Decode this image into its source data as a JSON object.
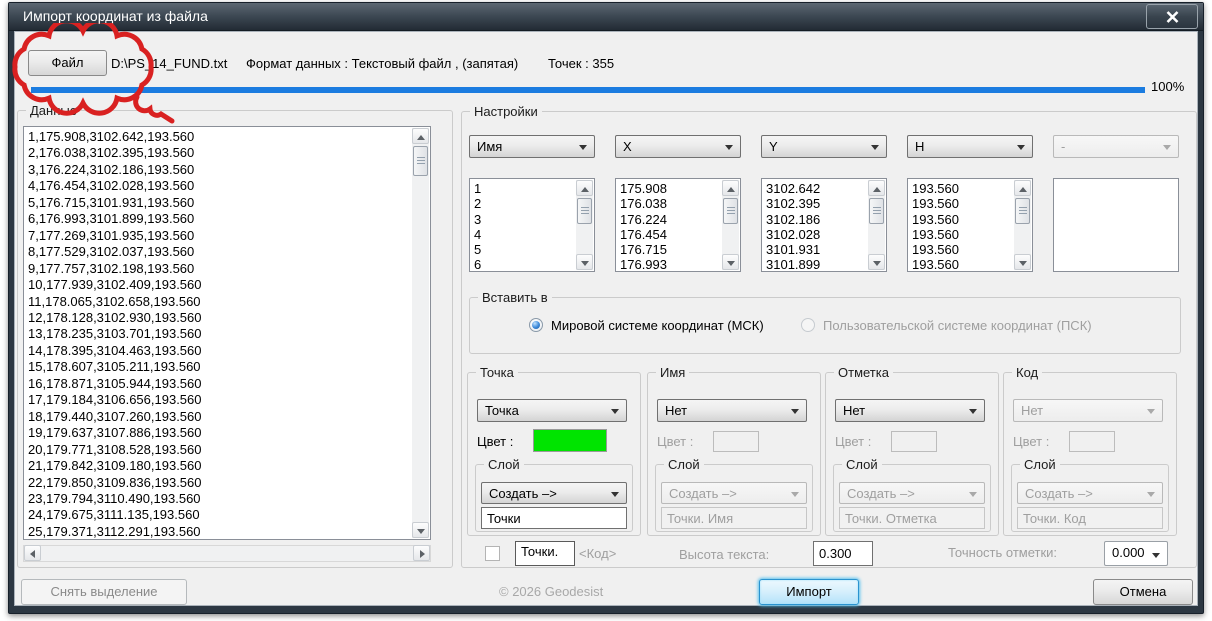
{
  "window": {
    "title": "Импорт координат из файла"
  },
  "header": {
    "file_button": "Файл",
    "file_path": "D:\\PS_14_FUND.txt",
    "format_text": "Формат данных : Текстовый файл , (запятая)",
    "points_text": "Точек : 355",
    "progress_percent": "100%"
  },
  "data_panel": {
    "title": "Данные",
    "rows": [
      "1,175.908,3102.642,193.560",
      "2,176.038,3102.395,193.560",
      "3,176.224,3102.186,193.560",
      "4,176.454,3102.028,193.560",
      "5,176.715,3101.931,193.560",
      "6,176.993,3101.899,193.560",
      "7,177.269,3101.935,193.560",
      "8,177.529,3102.037,193.560",
      "9,177.757,3102.198,193.560",
      "10,177.939,3102.409,193.560",
      "11,178.065,3102.658,193.560",
      "12,178.128,3102.930,193.560",
      "13,178.235,3103.701,193.560",
      "14,178.395,3104.463,193.560",
      "15,178.607,3105.211,193.560",
      "16,178.871,3105.944,193.560",
      "17,179.184,3106.656,193.560",
      "18,179.440,3107.260,193.560",
      "19,179.637,3107.886,193.560",
      "20,179.771,3108.528,193.560",
      "21,179.842,3109.180,193.560",
      "22,179.850,3109.836,193.560",
      "23,179.794,3110.490,193.560",
      "24,179.675,3111.135,193.560",
      "25,179.371,3112.291,193.560"
    ]
  },
  "settings": {
    "title": "Настройки",
    "column_selectors": [
      "Имя",
      "X",
      "Y",
      "H",
      "-"
    ],
    "columns": {
      "name": [
        "1",
        "2",
        "3",
        "4",
        "5",
        "6"
      ],
      "x": [
        "175.908",
        "176.038",
        "176.224",
        "176.454",
        "176.715",
        "176.993"
      ],
      "y": [
        "3102.642",
        "3102.395",
        "3102.186",
        "3102.028",
        "3101.931",
        "3101.899"
      ],
      "h": [
        "193.560",
        "193.560",
        "193.560",
        "193.560",
        "193.560",
        "193.560"
      ]
    },
    "insert_into": {
      "title": "Вставить в",
      "option_world": "Мировой системе координат (МСК)",
      "option_user": "Пользовательской системе координат (ПСК)"
    },
    "groups": {
      "point": {
        "title": "Точка",
        "value": "Точка",
        "color_label": "Цвет :",
        "layer_title": "Слой",
        "layer_mode": "Создать –>",
        "layer_name": "Точки"
      },
      "name": {
        "title": "Имя",
        "value": "Нет",
        "color_label": "Цвет :",
        "layer_title": "Слой",
        "layer_mode": "Создать –>",
        "layer_name": "Точки. Имя"
      },
      "mark": {
        "title": "Отметка",
        "value": "Нет",
        "color_label": "Цвет :",
        "layer_title": "Слой",
        "layer_mode": "Создать –>",
        "layer_name": "Точки. Отметка"
      },
      "code": {
        "title": "Код",
        "value": "Нет",
        "color_label": "Цвет :",
        "layer_title": "Слой",
        "layer_mode": "Создать –>",
        "layer_name": "Точки. Код"
      }
    },
    "bottom": {
      "points_prefix": "Точки.",
      "code_placeholder": "<Код>",
      "text_height_label": "Высота текста:",
      "text_height_value": "0.300",
      "precision_label": "Точность отметки:",
      "precision_value": "0.000"
    }
  },
  "footer": {
    "deselect": "Снять выделение",
    "copyright": "© 2026 Geodesist",
    "import": "Импорт",
    "cancel": "Отмена"
  },
  "colors": {
    "progress": "#1b7ce0",
    "point_color": "#00e400",
    "annotation": "#d92121"
  }
}
